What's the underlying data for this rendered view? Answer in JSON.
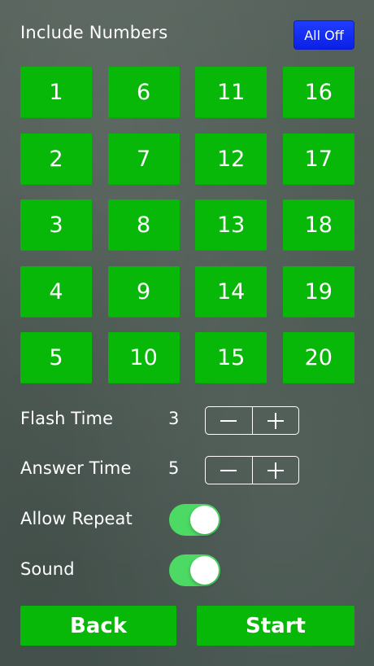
{
  "header": {
    "title": "Include Numbers",
    "all_off_label": "All Off"
  },
  "numbers": [
    "1",
    "6",
    "11",
    "16",
    "2",
    "7",
    "12",
    "17",
    "3",
    "8",
    "13",
    "18",
    "4",
    "9",
    "14",
    "19",
    "5",
    "10",
    "15",
    "20"
  ],
  "settings": {
    "flash_time": {
      "label": "Flash Time",
      "value": "3"
    },
    "answer_time": {
      "label": "Answer Time",
      "value": "5"
    },
    "allow_repeat": {
      "label": "Allow Repeat",
      "on": true
    },
    "sound": {
      "label": "Sound",
      "on": true
    }
  },
  "stepper": {
    "minus_icon": "minus-icon",
    "plus_icon": "plus-icon"
  },
  "buttons": {
    "back_label": "Back",
    "start_label": "Start"
  },
  "colors": {
    "number_green": "#08b808",
    "toggle_green": "#4cd964",
    "all_off_blue": "#0b20e6",
    "chalkboard": "#4c5a52"
  }
}
